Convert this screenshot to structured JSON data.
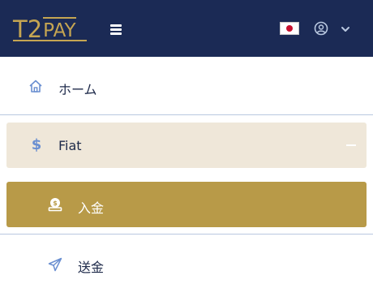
{
  "brand": {
    "logo_part1": "T2",
    "logo_part2": "PAY",
    "logo_color": "#c5a552",
    "header_bg": "#1b2a55"
  },
  "header": {
    "menu_icon": "hamburger-icon",
    "language_flag": "japan-flag",
    "user_icon": "user-circle-icon",
    "dropdown_icon": "chevron-down-icon"
  },
  "sidebar": {
    "items": [
      {
        "label": "ホーム",
        "icon": "home-icon"
      },
      {
        "label": "Fiat",
        "icon": "dollar-icon",
        "expanded": true
      },
      {
        "label": "入金",
        "icon": "deposit-icon",
        "active": true
      },
      {
        "label": "送金",
        "icon": "paper-plane-icon"
      }
    ],
    "active_bg": "#b89a48",
    "group_bg": "#efe7d9"
  }
}
